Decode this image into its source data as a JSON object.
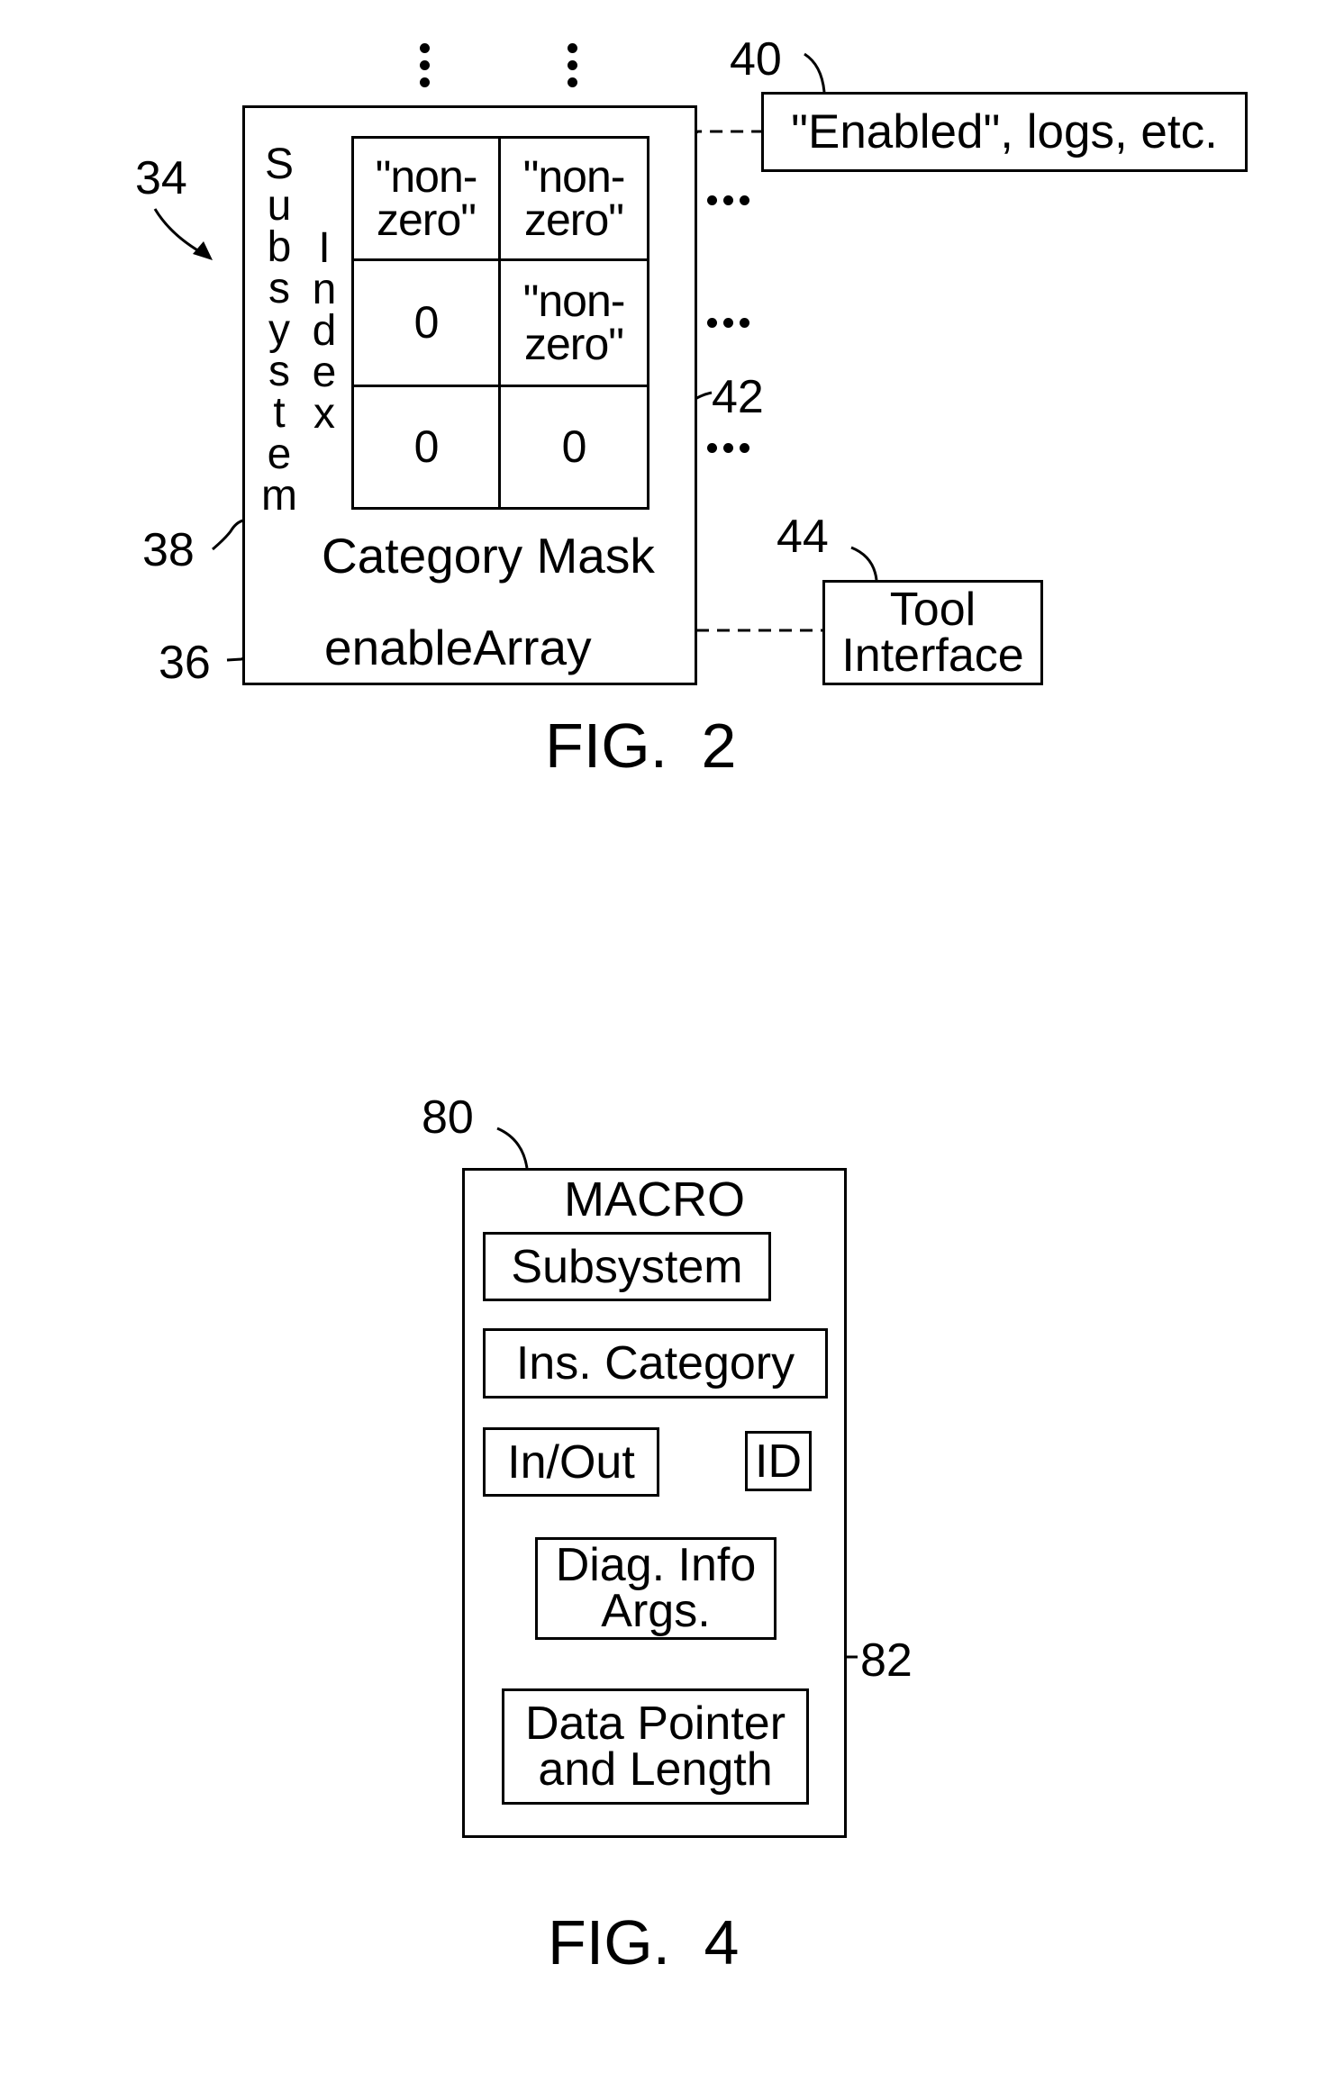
{
  "fig2": {
    "caption": "FIG. 2",
    "ref_labels": {
      "r34": "34",
      "r38": "38",
      "r36": "36",
      "r40": "40",
      "r42": "42",
      "r44": "44"
    },
    "vertical_label_subsystem": [
      "S",
      "u",
      "b",
      "s",
      "y",
      "s",
      "t",
      "e",
      "m"
    ],
    "vertical_label_index": [
      "I",
      "n",
      "d",
      "e",
      "x"
    ],
    "grid": {
      "rows": [
        [
          "\"non-\nzero\"",
          "\"non-\nzero\""
        ],
        [
          "0",
          "\"non-\nzero\""
        ],
        [
          "0",
          "0"
        ]
      ]
    },
    "category_mask_label": "Category Mask",
    "enable_array_label": "enableArray",
    "enabled_box_label": "\"Enabled\", logs, etc.",
    "tool_interface_label": "Tool\nInterface"
  },
  "fig4": {
    "caption": "FIG. 4",
    "ref_labels": {
      "r80": "80",
      "r82": "82"
    },
    "macro_title": "MACRO",
    "fields": {
      "subsystem": "Subsystem",
      "ins_category": "Ins. Category",
      "in_out": "In/Out",
      "id": "ID",
      "diag_info": "Diag. Info\nArgs.",
      "data_pointer": "Data Pointer\nand Length"
    }
  }
}
